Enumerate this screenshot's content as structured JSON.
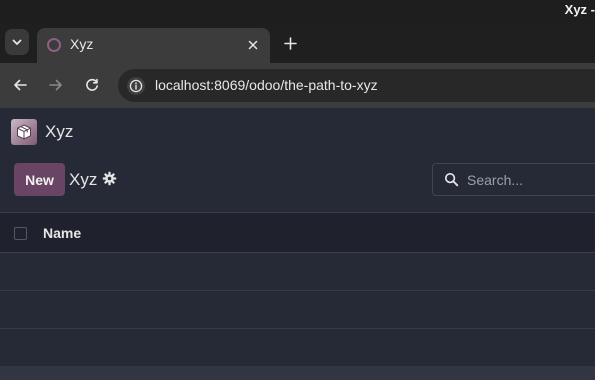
{
  "window": {
    "title": "Xyz -"
  },
  "browser": {
    "tab_title": "Xyz",
    "url": "localhost:8069/odoo/the-path-to-xyz",
    "favicon_color": "#8f5f86"
  },
  "app": {
    "name": "Xyz",
    "icon": "app-box-icon"
  },
  "control_panel": {
    "new_label": "New",
    "breadcrumb": "Xyz",
    "search_placeholder": "Search...",
    "accent_color": "#6a4465"
  },
  "list": {
    "columns": [
      "Name"
    ],
    "rows": []
  }
}
